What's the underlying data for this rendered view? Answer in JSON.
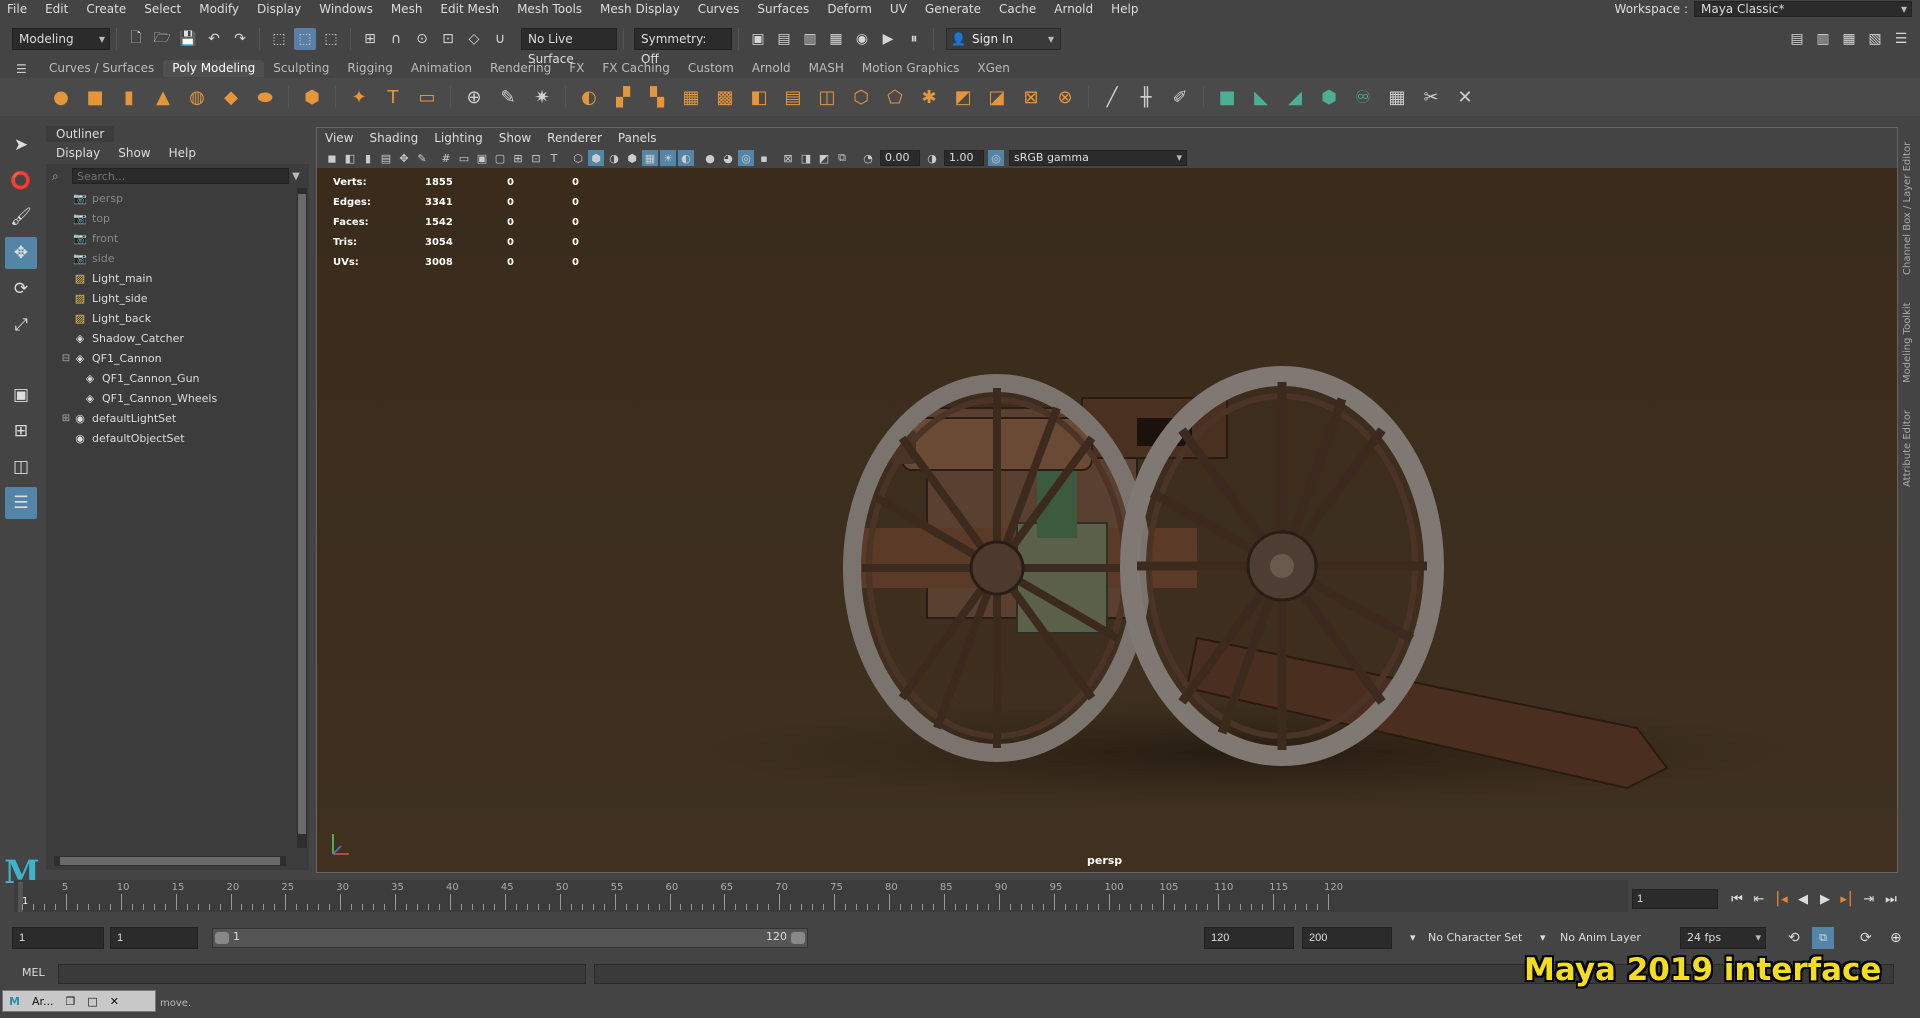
{
  "menubar": {
    "items": [
      "File",
      "Edit",
      "Create",
      "Select",
      "Modify",
      "Display",
      "Windows",
      "Mesh",
      "Edit Mesh",
      "Mesh Tools",
      "Mesh Display",
      "Curves",
      "Surfaces",
      "Deform",
      "UV",
      "Generate",
      "Cache",
      "Arnold",
      "Help"
    ],
    "workspace_label": "Workspace :",
    "workspace_value": "Maya Classic*"
  },
  "statusline": {
    "menuset": "Modeling",
    "live_surface": "No Live Surface",
    "symmetry": "Symmetry: Off",
    "sign_in": "Sign In"
  },
  "shelf": {
    "tabs": [
      "Curves / Surfaces",
      "Poly Modeling",
      "Sculpting",
      "Rigging",
      "Animation",
      "Rendering",
      "FX",
      "FX Caching",
      "Custom",
      "Arnold",
      "MASH",
      "Motion Graphics",
      "XGen"
    ],
    "active_tab": "Poly Modeling"
  },
  "outliner": {
    "title": "Outliner",
    "menu": [
      "Display",
      "Show",
      "Help"
    ],
    "search_placeholder": "Search...",
    "items": [
      {
        "label": "persp"
      },
      {
        "label": "top"
      },
      {
        "label": "front"
      },
      {
        "label": "side"
      },
      {
        "label": "Light_main"
      },
      {
        "label": "Light_side"
      },
      {
        "label": "Light_back"
      },
      {
        "label": "Shadow_Catcher"
      },
      {
        "label": "QF1_Cannon"
      },
      {
        "label": "QF1_Cannon_Gun"
      },
      {
        "label": "QF1_Cannon_Wheels"
      },
      {
        "label": "defaultLightSet"
      },
      {
        "label": "defaultObjectSet"
      }
    ]
  },
  "viewport": {
    "menu": [
      "View",
      "Shading",
      "Lighting",
      "Show",
      "Renderer",
      "Panels"
    ],
    "exposure": "0.00",
    "gamma": "1.00",
    "color_space": "sRGB gamma",
    "camera": "persp",
    "hud": [
      {
        "label": "Verts:",
        "v": "1855",
        "a": "0",
        "b": "0"
      },
      {
        "label": "Edges:",
        "v": "3341",
        "a": "0",
        "b": "0"
      },
      {
        "label": "Faces:",
        "v": "1542",
        "a": "0",
        "b": "0"
      },
      {
        "label": "Tris:",
        "v": "3054",
        "a": "0",
        "b": "0"
      },
      {
        "label": "UVs:",
        "v": "3008",
        "a": "0",
        "b": "0"
      }
    ]
  },
  "right_panels": [
    "Channel Box / Layer Editor",
    "Modeling Toolkit",
    "Attribute Editor"
  ],
  "timeline": {
    "current_frame_marker": "1",
    "ticks": [
      "5",
      "10",
      "15",
      "20",
      "25",
      "30",
      "35",
      "40",
      "45",
      "50",
      "55",
      "60",
      "65",
      "70",
      "75",
      "80",
      "85",
      "90",
      "95",
      "100",
      "105",
      "110",
      "115",
      "120"
    ],
    "current_frame": "1"
  },
  "range": {
    "start": "1",
    "playback_start": "1",
    "slider_start": "1",
    "slider_end": "120",
    "playback_end": "120",
    "end": "200",
    "character_set": "No Character Set",
    "anim_layer": "No Anim Layer",
    "fps": "24 fps"
  },
  "command": {
    "mel_label": "MEL",
    "help_text": "move."
  },
  "taskbar": {
    "label": "Ar..."
  },
  "overlay": {
    "caption": "Maya 2019 interface"
  }
}
